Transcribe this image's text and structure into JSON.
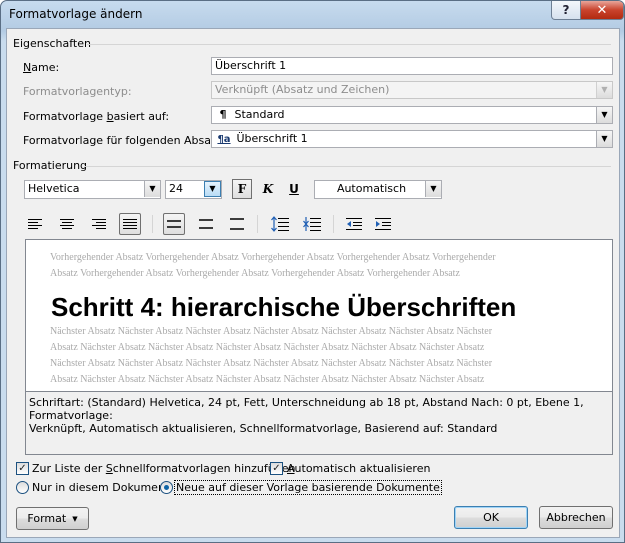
{
  "window": {
    "title": "Formatvorlage ändern",
    "help": "?",
    "close": "✕"
  },
  "properties": {
    "group_title": "Eigenschaften",
    "name_label": "Name:",
    "name_value": "Überschrift 1",
    "type_label": "Formatvorlagentyp:",
    "type_value": "Verknüpft (Absatz und Zeichen)",
    "based_on_label": "Formatvorlage basiert auf:",
    "based_on_value": "Standard",
    "based_on_icon": "¶",
    "next_label": "Formatvorlage für folgenden Absatz:",
    "next_value": "Überschrift 1",
    "next_icon": "¶a"
  },
  "formatting": {
    "group_title": "Formatierung",
    "font": "Helvetica",
    "size": "24",
    "bold": "F",
    "italic": "K",
    "underline": "U",
    "color": "Automatisch"
  },
  "preview": {
    "prev_line1": "Vorhergehender Absatz Vorhergehender Absatz Vorhergehender Absatz Vorhergehender Absatz Vorhergehender",
    "prev_line2": "Absatz Vorhergehender Absatz Vorhergehender Absatz Vorhergehender Absatz Vorhergehender Absatz",
    "heading": "Schritt 4: hierarchische Überschriften",
    "next_line1": "Nächster Absatz Nächster Absatz Nächster Absatz Nächster Absatz Nächster Absatz Nächster Absatz Nächster",
    "next_line2": "Absatz Nächster Absatz Nächster Absatz Nächster Absatz Nächster Absatz Nächster Absatz Nächster Absatz",
    "next_line3": "Nächster Absatz Nächster Absatz Nächster Absatz Nächster Absatz Nächster Absatz Nächster Absatz Nächster",
    "next_line4": "Absatz Nächster Absatz Nächster Absatz Nächster Absatz Nächster Absatz Nächster Absatz Nächster Absatz"
  },
  "description": {
    "line1": "Schriftart: (Standard) Helvetica, 24 pt, Fett, Unterschneidung ab 18 pt, Abstand Nach:  0 pt, Ebene 1, Formatvorlage:",
    "line2": "Verknüpft, Automatisch aktualisieren, Schnellformatvorlage, Basierend auf: Standard"
  },
  "options": {
    "add_to_quick_label": "Zur Liste der Schnellformatvorlagen hinzufügen",
    "add_to_quick_checked": true,
    "auto_update_label": "Automatisch aktualisieren",
    "auto_update_checked": true,
    "only_doc_label": "Nur in diesem Dokument",
    "new_docs_label": "Neue auf dieser Vorlage basierende Dokumente",
    "selected_scope": "new_docs"
  },
  "buttons": {
    "format": "Format",
    "ok": "OK",
    "cancel": "Abbrechen"
  }
}
